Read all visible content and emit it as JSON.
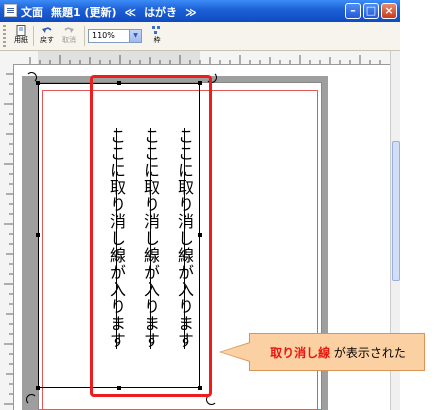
{
  "window": {
    "title_app": "文面",
    "title_doc": "無題1 (更新)",
    "title_sep": "≪",
    "title_section": "はがき",
    "title_sep2": "≫"
  },
  "toolbar": {
    "paper_label": "用紙",
    "undo_label": "戻す",
    "cancel_label": "取消",
    "zoom_value": "110%",
    "frame_label": "枠"
  },
  "document": {
    "text_lines": [
      "ここに取り消し線が入ります",
      "ここに取り消し線が入ります",
      "ここに取り消し線が入ります"
    ],
    "strikethrough": true
  },
  "callout": {
    "highlight": "取り消し線",
    "rest": " が表示された"
  },
  "colors": {
    "highlight_frame": "#ee1c1c",
    "callout_fill": "#fbd1a3",
    "callout_emphasis": "#e8160f",
    "titlebar": "#1d5fd6"
  }
}
